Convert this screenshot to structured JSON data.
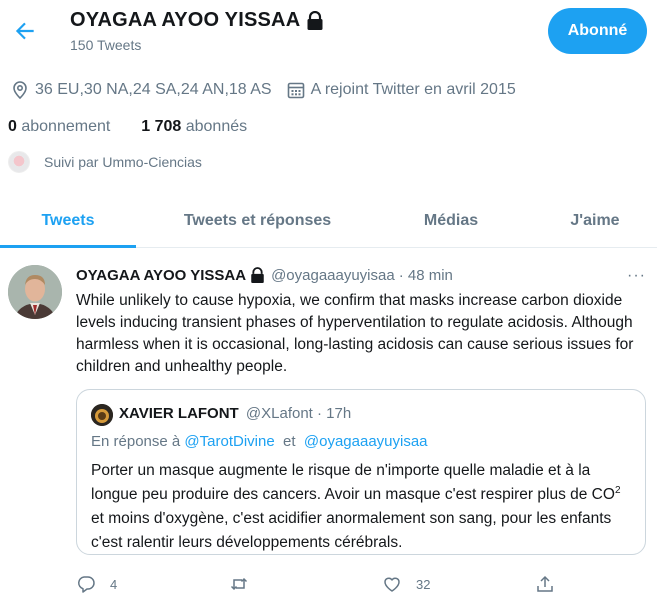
{
  "header": {
    "title": "OYAGAA AYOO YISSAA",
    "tweet_count": "150 Tweets",
    "follow_button": "Abonné",
    "back_icon": "arrow-left-icon",
    "lock_icon": "lock-icon"
  },
  "profile": {
    "location": "36 EU,30 NA,24 SA,24 AN,18 AS",
    "joined": "A rejoint Twitter en avril 2015",
    "following_count": "0",
    "following_label": "abonnement",
    "followers_count": "1 708",
    "followers_label": "abonnés",
    "followed_by": "Suivi par Ummo-Ciencias"
  },
  "tabs": [
    {
      "label": "Tweets",
      "active": true
    },
    {
      "label": "Tweets et réponses",
      "active": false
    },
    {
      "label": "Médias",
      "active": false
    },
    {
      "label": "J'aime",
      "active": false
    }
  ],
  "tweet": {
    "name": "OYAGAA AYOO YISSAA",
    "handle": "@oyagaaayuyisaa",
    "time": "· 48 min",
    "more": "···",
    "text": "While unlikely to cause hypoxia, we confirm that masks increase carbon dioxide levels inducing transient phases of hyperventilation to regulate acidosis. Although harmless when it is occasional, long-lasting acidosis can cause serious issues for children and unhealthy people.",
    "quote": {
      "name": "XAVIER LAFONT",
      "handle": "@XLafont · 17h",
      "reply_prefix": "En réponse à",
      "reply_mention_1": "@TarotDivine",
      "reply_and": "et",
      "reply_mention_2": "@oyagaaayuyisaa",
      "text_part1": "Porter un masque augmente le risque de n'importe quelle maladie et à la longue peu produire des cancers. Avoir un masque c'est respirer plus de CO",
      "text_sup": "2",
      "text_part2": " et moins d'oxygène, c'est acidifier anormalement son sang, pour les enfants c'est ralentir leurs développements cérébrals."
    },
    "actions": {
      "reply_count": "4",
      "retweet_count": "",
      "like_count": "32"
    }
  },
  "colors": {
    "accent": "#1da1f2",
    "muted": "#657786",
    "text": "#14171a",
    "border": "#e6ecf0"
  }
}
